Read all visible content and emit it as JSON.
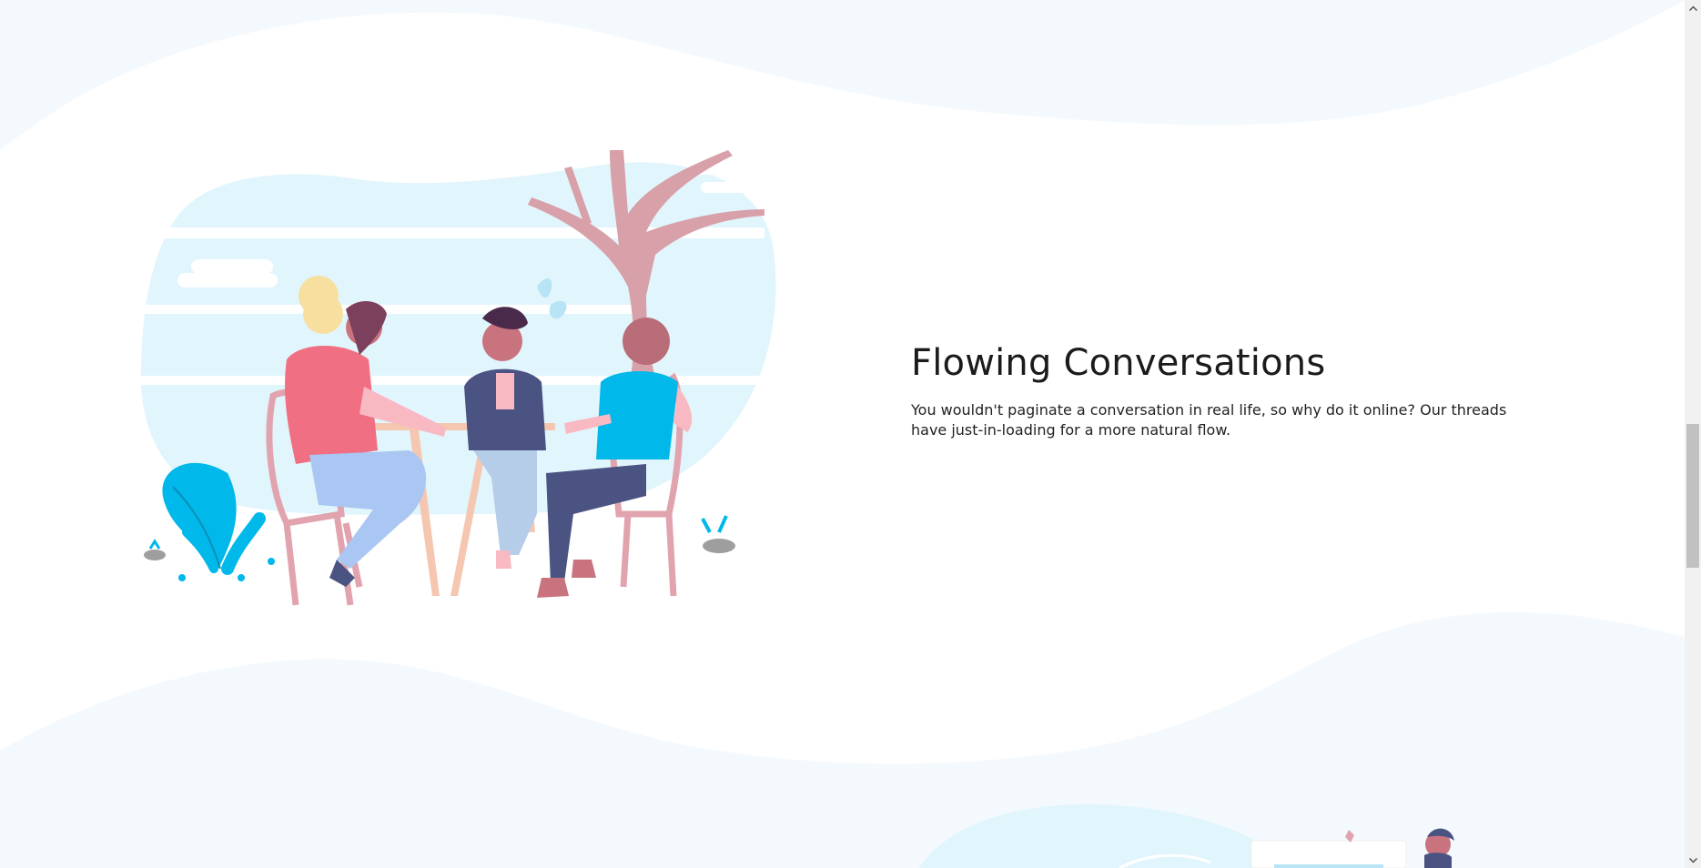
{
  "feature": {
    "title": "Flowing Conversations",
    "description": "You wouldn't paginate a conversation in real life, so why do it online? Our threads have just-in-loading for a more natural flow."
  },
  "illustrations": {
    "main": "people-conversing-at-table-illustration",
    "next_section": "next-feature-illustration"
  },
  "scrollbar": {
    "position_fraction": 0.52
  },
  "colors": {
    "wave": "#f3f9fd",
    "sky": "#e1f5fc",
    "accent_blue": "#00b8ea",
    "text": "#1b1b1b"
  }
}
